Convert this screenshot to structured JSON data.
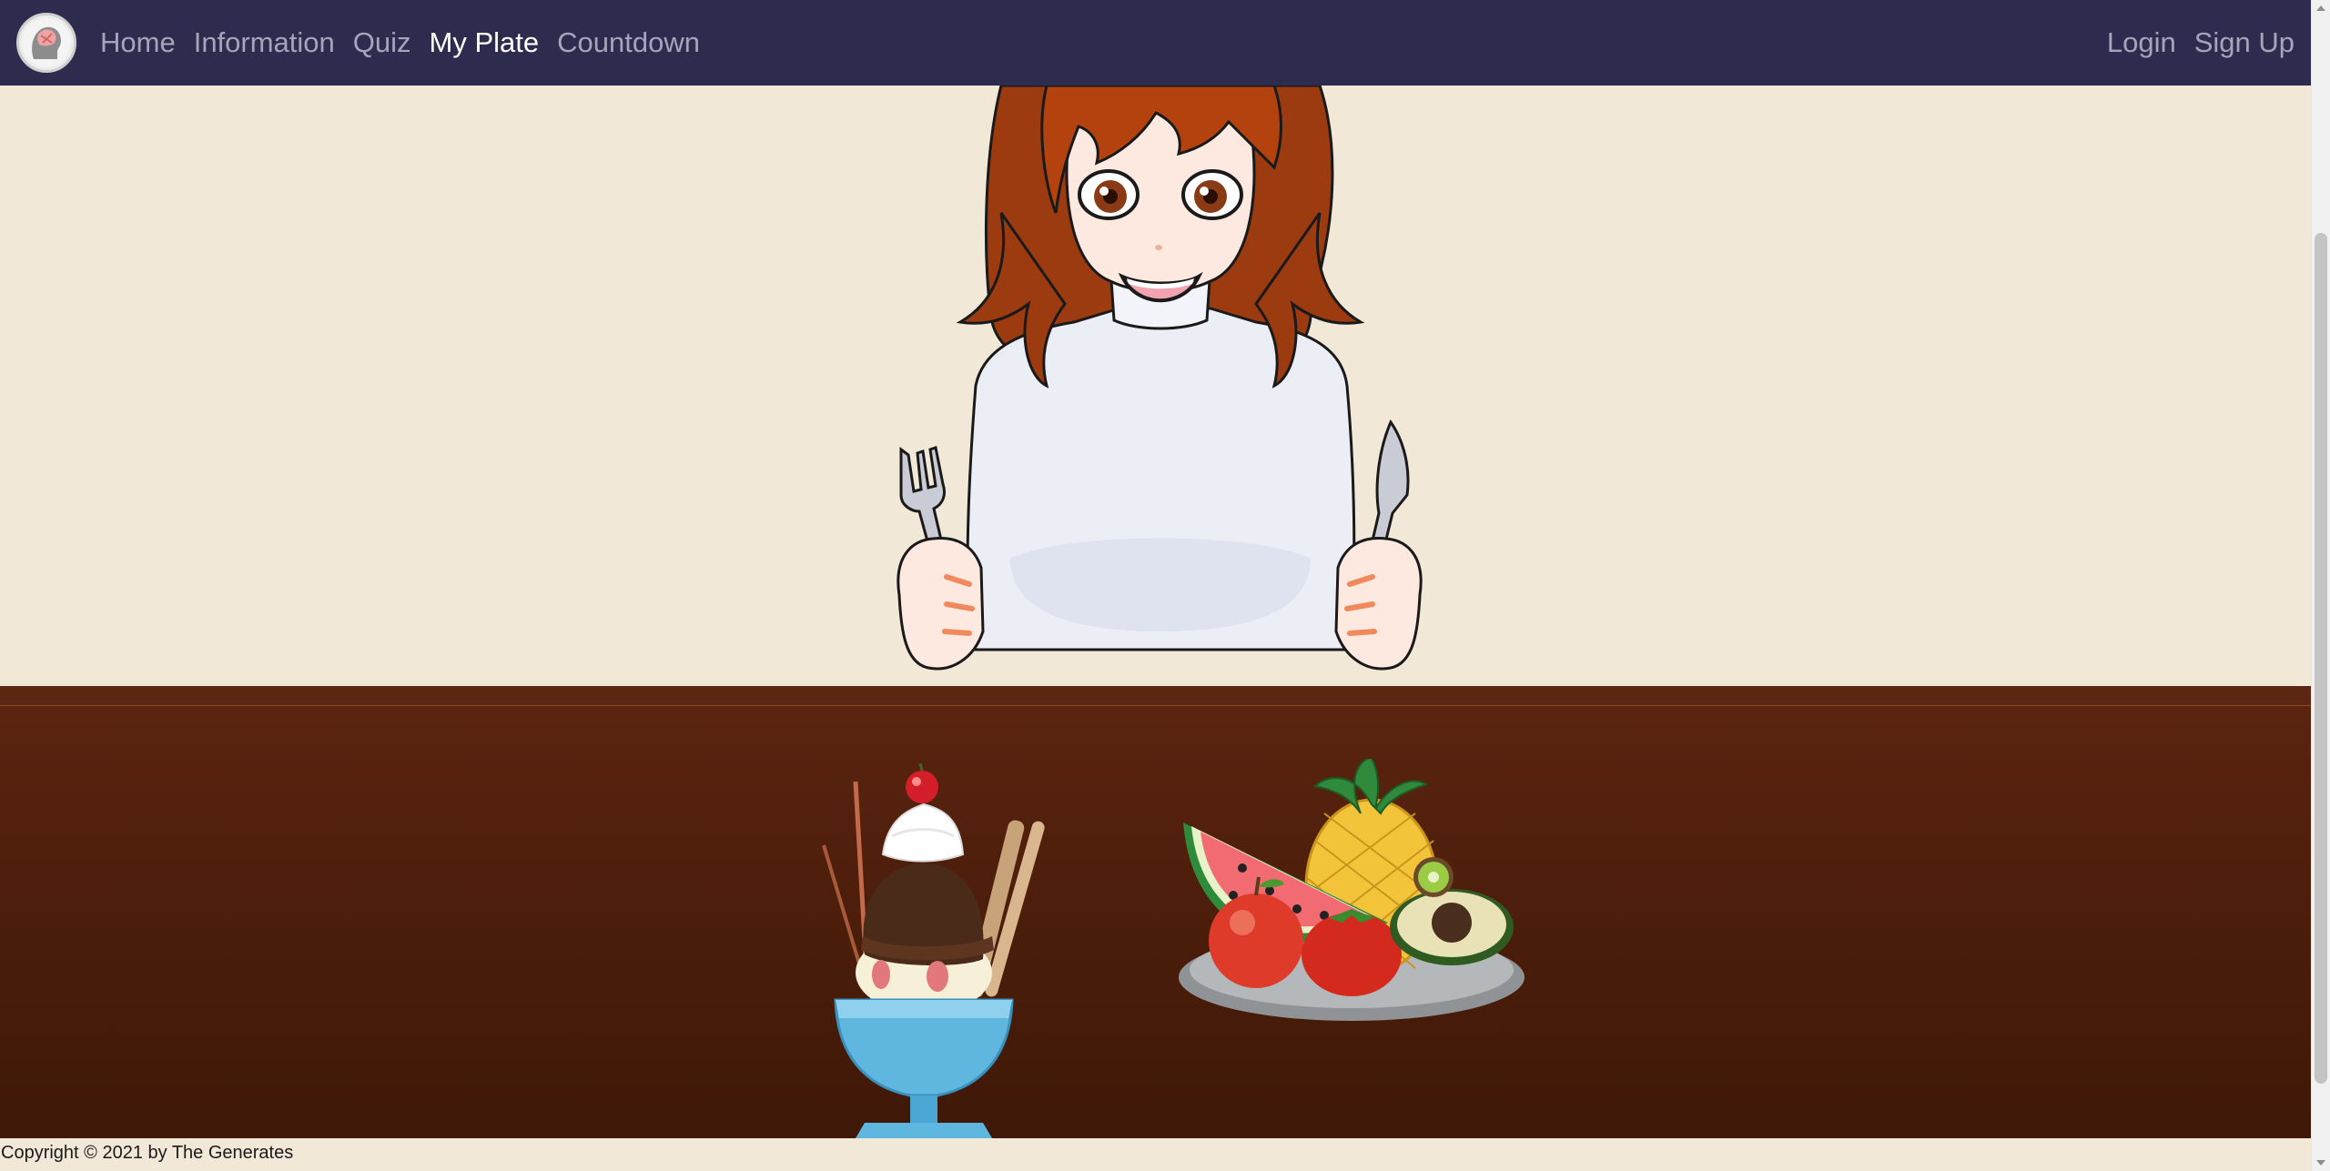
{
  "nav": {
    "logo_icon": "brain-head-logo-icon",
    "links": [
      {
        "label": "Home"
      },
      {
        "label": "Information"
      },
      {
        "label": "Quiz"
      },
      {
        "label": "My Plate",
        "active": true
      },
      {
        "label": "Countdown"
      }
    ],
    "auth": {
      "login": "Login",
      "signup": "Sign Up"
    }
  },
  "scene": {
    "character_icon": "anime-girl-with-fork-and-knife-icon",
    "items": [
      {
        "icon": "ice-cream-sundae-icon"
      },
      {
        "icon": "fruit-plate-icon"
      }
    ]
  },
  "footer": {
    "copyright": "Copyright © 2021 by The Generates"
  },
  "colors": {
    "navbar": "#2d2c4f",
    "nav_text": "#a4a5ba",
    "nav_active": "#ffffff",
    "wall": "#f2e8d8",
    "table": "#4a1d0a"
  }
}
